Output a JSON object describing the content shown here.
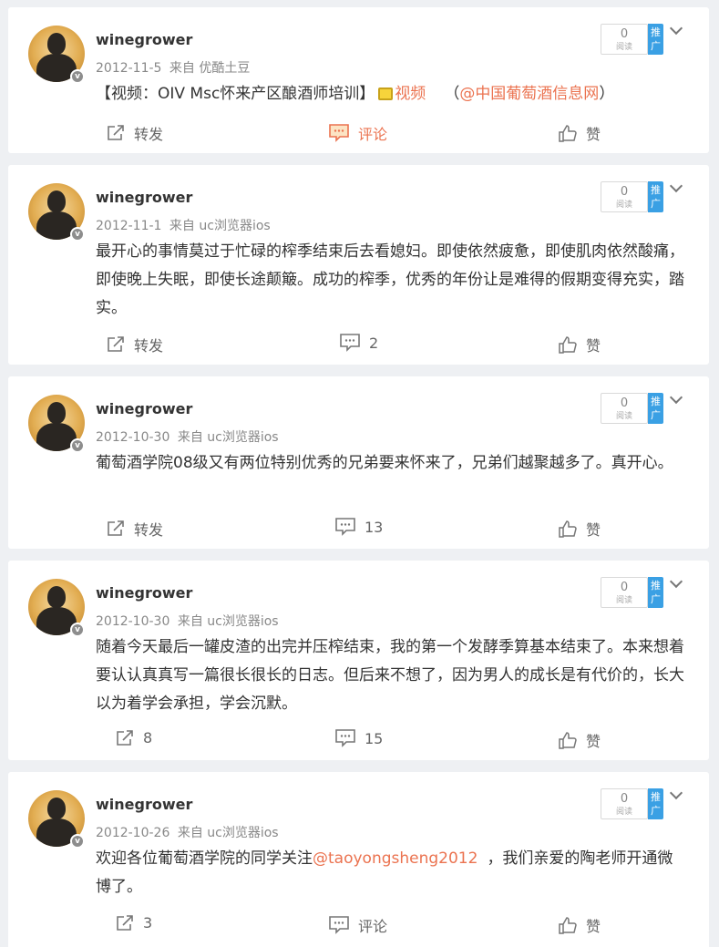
{
  "posts": [
    {
      "username": "winegrower",
      "date": "2012-11-5",
      "source_prefix": "来自",
      "source": "优酷土豆",
      "content_prefix": "【视频：OIV Msc怀来产区酿酒师培训】",
      "video_label": "视频",
      "paren_open": "（",
      "mention": "@中国葡萄酒信息网",
      "paren_close": "）",
      "read_count": "0",
      "read_label": "阅读",
      "promote_label": "推广",
      "forward": "转发",
      "comment": "评论",
      "like": "赞"
    },
    {
      "username": "winegrower",
      "date": "2012-11-1",
      "source_prefix": "来自",
      "source": "uc浏览器ios",
      "content": "最开心的事情莫过于忙碌的榨季结束后去看媳妇。即使依然疲惫，即使肌肉依然酸痛，即使晚上失眠，即使长途颠簸。成功的榨季，优秀的年份让是难得的假期变得充实，踏实。",
      "read_count": "0",
      "read_label": "阅读",
      "promote_label": "推广",
      "forward": "转发",
      "comment": "2",
      "like": "赞"
    },
    {
      "username": "winegrower",
      "date": "2012-10-30",
      "source_prefix": "来自",
      "source": "uc浏览器ios",
      "content": "葡萄酒学院08级又有两位特别优秀的兄弟要来怀来了，兄弟们越聚越多了。真开心。",
      "read_count": "0",
      "read_label": "阅读",
      "promote_label": "推广",
      "forward": "转发",
      "comment": "13",
      "like": "赞"
    },
    {
      "username": "winegrower",
      "date": "2012-10-30",
      "source_prefix": "来自",
      "source": "uc浏览器ios",
      "content": "随着今天最后一罐皮渣的出完并压榨结束，我的第一个发酵季算基本结束了。本来想着要认认真真写一篇很长很长的日志。但后来不想了，因为男人的成长是有代价的，长大以为着学会承担，学会沉默。",
      "read_count": "0",
      "read_label": "阅读",
      "promote_label": "推广",
      "forward": "8",
      "comment": "15",
      "like": "赞"
    },
    {
      "username": "winegrower",
      "date": "2012-10-26",
      "source_prefix": "来自",
      "source": "uc浏览器ios",
      "content_prefix": "欢迎各位葡萄酒学院的同学关注",
      "mention": "@taoyongsheng2012",
      "content_suffix": "，我们亲爱的陶老师开通微博了。",
      "read_count": "0",
      "read_label": "阅读",
      "promote_label": "推广",
      "forward": "3",
      "comment": "评论",
      "like": "赞"
    }
  ],
  "colors": {
    "accent": "#eb7350",
    "promote": "#3aa0e4",
    "background": "#eef0f3"
  },
  "icons": [
    "share-icon",
    "comment-icon",
    "like-icon",
    "verified-badge-icon",
    "chevron-down-icon",
    "video-icon"
  ]
}
